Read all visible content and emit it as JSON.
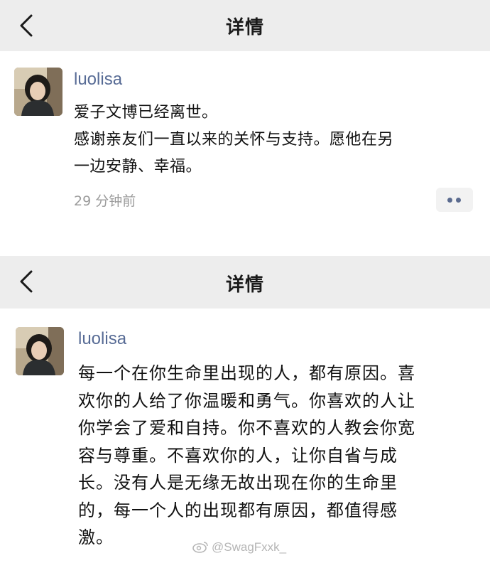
{
  "screens": [
    {
      "nav": {
        "back_icon": "chevron-left-icon",
        "title": "详情"
      },
      "post": {
        "username": "luolisa",
        "lines": [
          "爱子文博已经离世。",
          "感谢亲友们一直以来的关怀与支持。愿他在另",
          "一边安静、幸福。"
        ],
        "timestamp": "29 分钟前",
        "more_icon": "more-dots-icon"
      }
    },
    {
      "nav": {
        "back_icon": "chevron-left-icon",
        "title": "详情"
      },
      "post": {
        "username": "luolisa",
        "lines": [
          "每一个在你生命里出现的人，都有原因。喜",
          "欢你的人给了你温暖和勇气。你喜欢的人让",
          "你学会了爱和自持。你不喜欢的人教会你宽",
          "容与尊重。不喜欢你的人，让你自省与成",
          "长。没有人是无缘无故出现在你的生命里",
          "的，每一个人的出现都有原因，都值得感",
          "激。"
        ]
      }
    }
  ],
  "watermark": {
    "icon": "weibo-icon",
    "text": "@SwagFxxk_"
  },
  "colors": {
    "nav_bg": "#ededed",
    "username": "#576b95",
    "timestamp": "#9b9b9b"
  }
}
